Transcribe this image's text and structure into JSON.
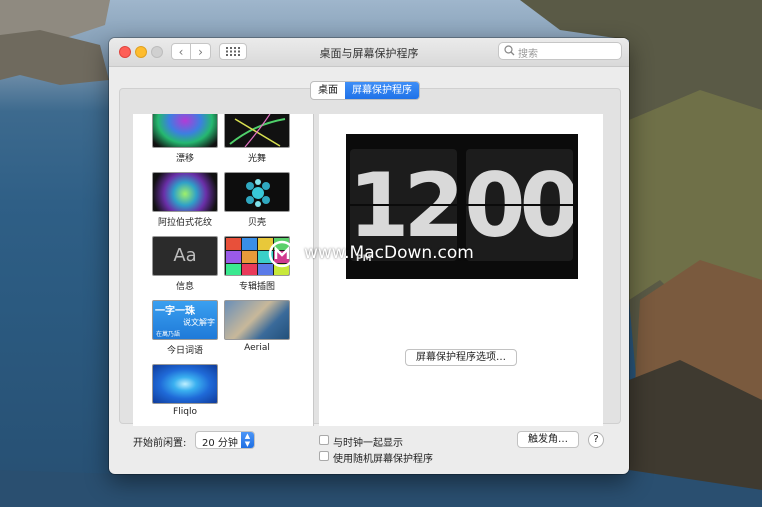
{
  "window": {
    "title": "桌面与屏幕保护程序",
    "search_placeholder": "搜索"
  },
  "tabs": [
    {
      "label": "桌面",
      "active": false
    },
    {
      "label": "屏幕保护程序",
      "active": true
    }
  ],
  "screensavers": [
    {
      "label": "漂移"
    },
    {
      "label": "光舞"
    },
    {
      "label": "阿拉伯式花纹"
    },
    {
      "label": "贝壳"
    },
    {
      "label": "信息",
      "thumb_text": "Aa"
    },
    {
      "label": "专辑插图"
    },
    {
      "label": "今日词语",
      "thumb_text_lines": [
        "一字一珠",
        "说文解字",
        "在萬乃語"
      ]
    },
    {
      "label": "Aerial"
    },
    {
      "label": "Fliqlo"
    }
  ],
  "preview": {
    "hours": "12",
    "minutes": "00",
    "ampm": "PM"
  },
  "options_button": "屏幕保护程序选项…",
  "idle": {
    "label": "开始前闲置:",
    "value": "20 分钟"
  },
  "checkboxes": [
    {
      "label": "与时钟一起显示",
      "checked": false
    },
    {
      "label": "使用随机屏幕保护程序",
      "checked": false
    }
  ],
  "hot_corners_button": "触发角…",
  "help_button": "?",
  "watermark": "www.MacDown.com",
  "colors": {
    "accent": "#1f72e8",
    "close": "#fe5f57",
    "minimize": "#febc2e"
  }
}
